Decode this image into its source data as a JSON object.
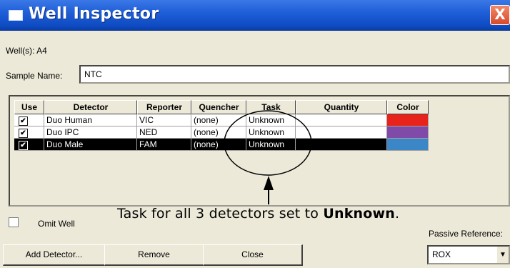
{
  "window": {
    "title": "Well Inspector",
    "close_glyph": "X",
    "icon": "window-icon"
  },
  "wells": {
    "label": "Well(s): A4"
  },
  "sample_name": {
    "label": "Sample Name:",
    "value": "NTC"
  },
  "table": {
    "columns": [
      "Use",
      "Detector",
      "Reporter",
      "Quencher",
      "Task",
      "Quantity",
      "Color"
    ],
    "rows": [
      {
        "use": true,
        "detector": "Duo Human",
        "reporter": "VIC",
        "quencher": "(none)",
        "task": "Unknown",
        "quantity": "",
        "color": "#e8231c",
        "selected": false
      },
      {
        "use": true,
        "detector": "Duo IPC",
        "reporter": "NED",
        "quencher": "(none)",
        "task": "Unknown",
        "quantity": "",
        "color": "#7f4aa8",
        "selected": false
      },
      {
        "use": true,
        "detector": "Duo Male",
        "reporter": "FAM",
        "quencher": "(none)",
        "task": "Unknown",
        "quantity": "",
        "color": "#3b86c6",
        "selected": true
      }
    ]
  },
  "omit_well": {
    "label": "Omit Well",
    "checked": false
  },
  "annotation": {
    "text": "Task for all 3 detectors set to ",
    "bold": "Unknown",
    "end": "."
  },
  "passive_reference": {
    "label": "Passive Reference:",
    "value": "ROX"
  },
  "buttons": {
    "add_detector": "Add Detector...",
    "remove": "Remove",
    "close": "Close"
  }
}
